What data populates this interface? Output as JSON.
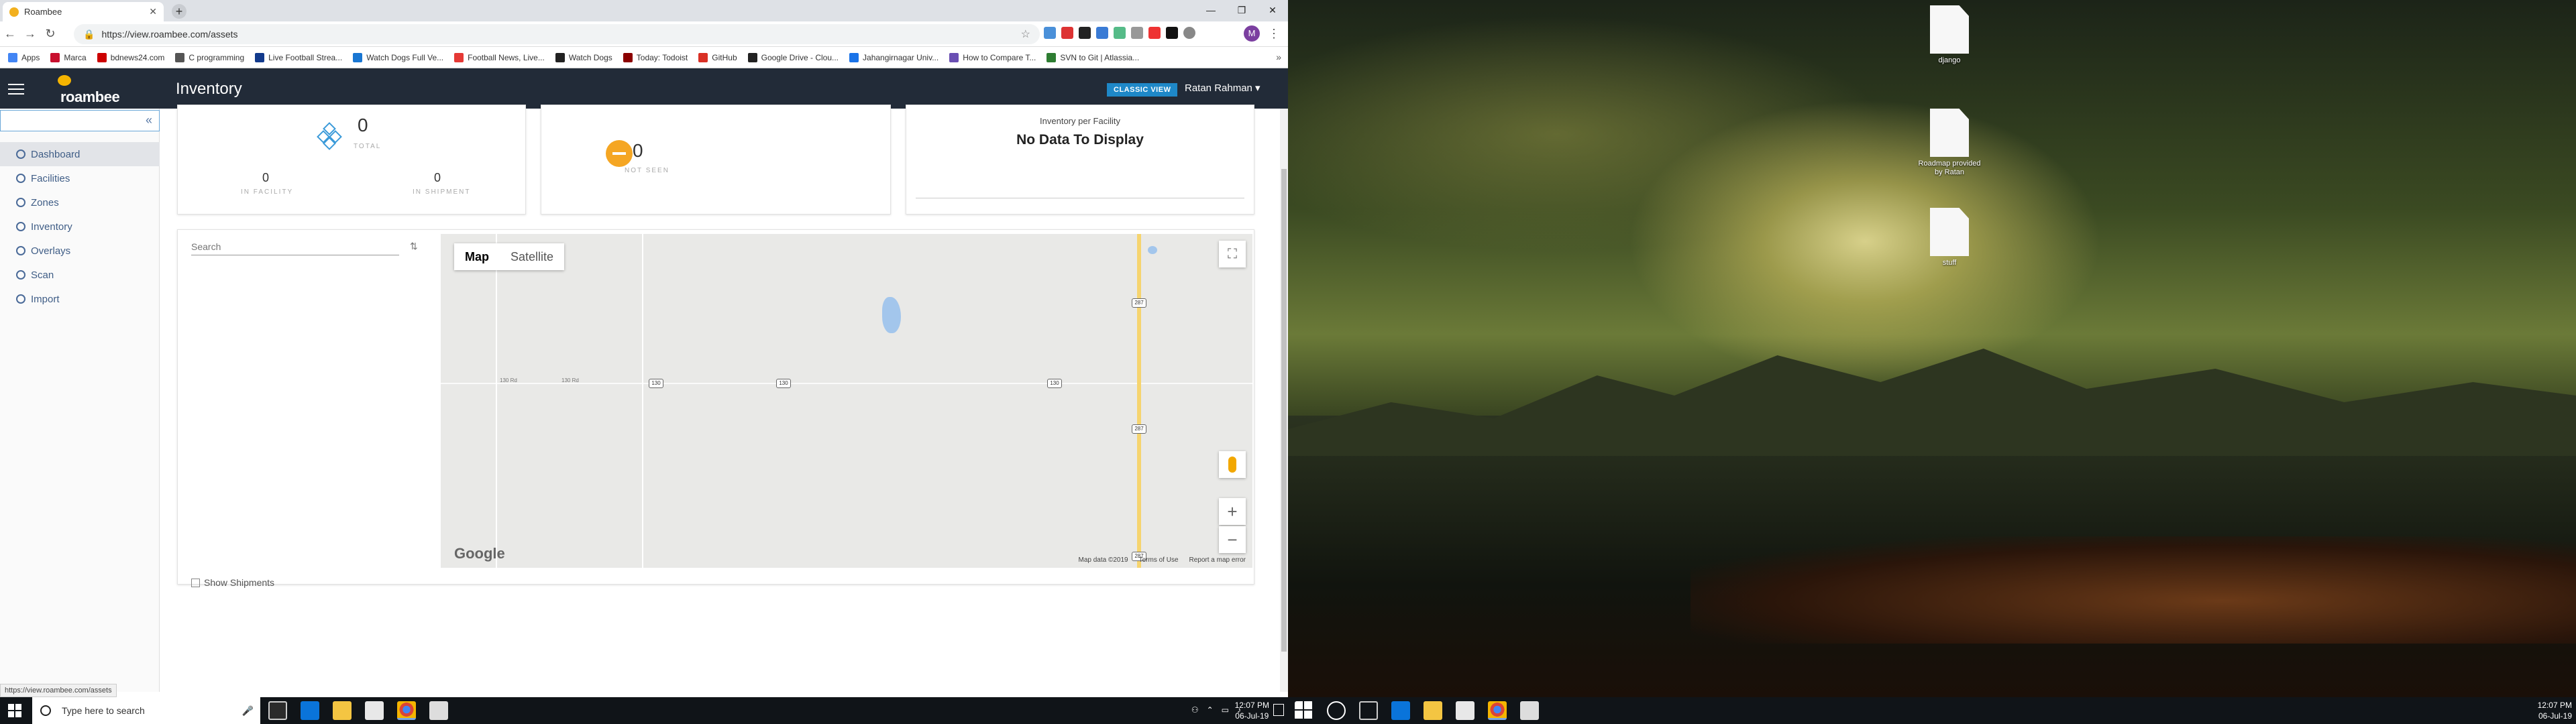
{
  "browser": {
    "tab_title": "Roambee",
    "url": "https://view.roambee.com/assets",
    "bookmarks": [
      "Apps",
      "Marca",
      "bdnews24.com",
      "C programming",
      "Live Football Strea...",
      "Watch Dogs Full Ve...",
      "Football News, Live...",
      "Watch Dogs",
      "Today: Todoist",
      "GitHub",
      "Google Drive - Clou...",
      "Jahangirnagar Univ...",
      "How to Compare T...",
      "SVN to Git | Atlassia..."
    ],
    "bookmark_colors": [
      "#4285f4",
      "#c8102e",
      "#cc0000",
      "#555555",
      "#123a8c",
      "#1976d2",
      "#e53935",
      "#222222",
      "#8b0000",
      "#d93025",
      "#222222",
      "#1a73e8",
      "#6a4fb3",
      "#2e7d32",
      "#2684ff"
    ],
    "profile_initial": "M",
    "status_url": "https://view.roambee.com/assets"
  },
  "app": {
    "brand": "roambee",
    "page_title": "Inventory",
    "classic_view": "CLASSIC VIEW",
    "user": "Ratan Rahman ▾"
  },
  "sidebar": {
    "collapse_icon": "«",
    "items": [
      {
        "label": "Dashboard",
        "active": true
      },
      {
        "label": "Facilities"
      },
      {
        "label": "Zones"
      },
      {
        "label": "Inventory"
      },
      {
        "label": "Overlays"
      },
      {
        "label": "Scan"
      },
      {
        "label": "Import"
      }
    ]
  },
  "cards": {
    "total": {
      "value": "0",
      "label": "TOTAL",
      "in_facility_value": "0",
      "in_facility_label": "IN FACILITY",
      "in_shipment_value": "0",
      "in_shipment_label": "IN SHIPMENT"
    },
    "not_seen": {
      "value": "0",
      "label": "NOT SEEN"
    },
    "facility": {
      "title": "Inventory per Facility",
      "empty": "No Data To Display"
    }
  },
  "map": {
    "search_placeholder": "Search",
    "map_label": "Map",
    "satellite_label": "Satellite",
    "zoom_in": "+",
    "zoom_out": "−",
    "fullscreen": "⛶",
    "google": "Google",
    "attribution": [
      "Map data ©2019",
      "Terms of Use",
      "Report a map error"
    ],
    "road_labels": [
      "130 Rd",
      "130 Rd"
    ],
    "shields": [
      "130",
      "130",
      "130",
      "287",
      "287",
      "287"
    ],
    "show_shipments": "Show Shipments"
  },
  "taskbar": {
    "search_placeholder": "Type here to search",
    "time": "12:07 PM",
    "date": "06-Jul-19"
  },
  "desktop": {
    "icons": [
      "django",
      "Roadmap provided by Ratan",
      "stuff"
    ]
  }
}
